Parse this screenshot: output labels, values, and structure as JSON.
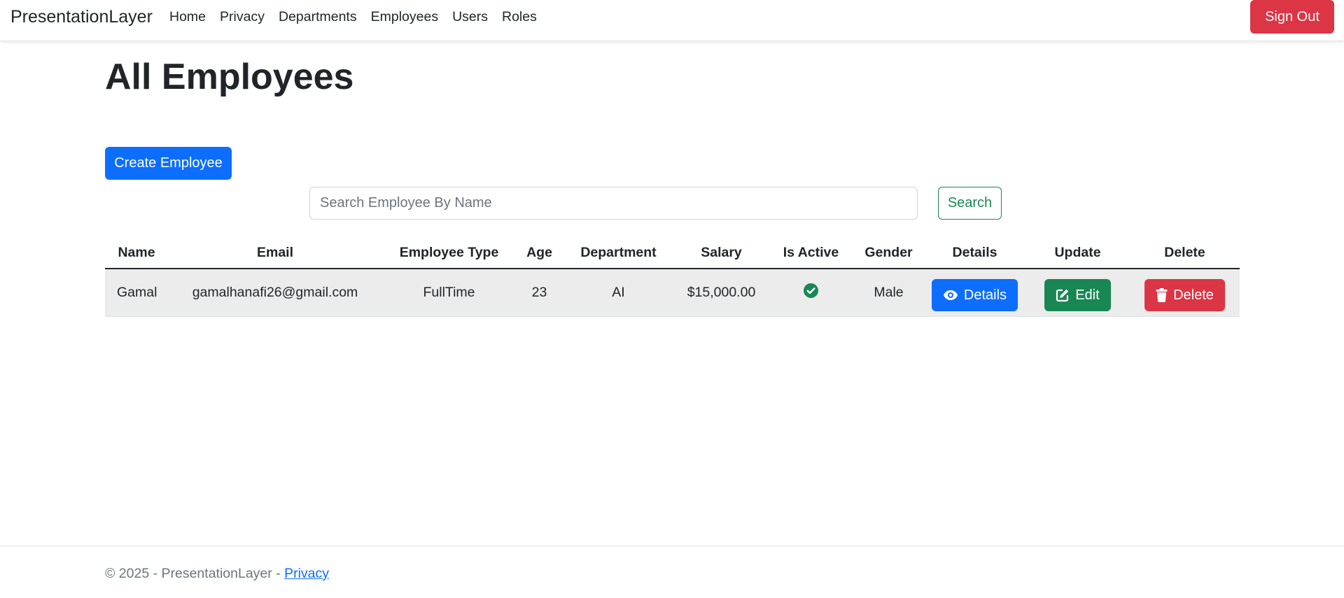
{
  "nav": {
    "brand": "PresentationLayer",
    "links": [
      "Home",
      "Privacy",
      "Departments",
      "Employees",
      "Users",
      "Roles"
    ],
    "signout": "Sign Out"
  },
  "page": {
    "title": "All Employees",
    "create_label": "Create Employee",
    "search_placeholder": "Search Employee By Name",
    "search_value": "",
    "search_label": "Search"
  },
  "table": {
    "headers": [
      "Name",
      "Email",
      "Employee Type",
      "Age",
      "Department",
      "Salary",
      "Is Active",
      "Gender",
      "Details",
      "Update",
      "Delete"
    ],
    "rows": [
      {
        "name": "Gamal",
        "email": "gamalhanafi26@gmail.com",
        "type": "FullTime",
        "age": "23",
        "department": "AI",
        "salary": "$15,000.00",
        "is_active": true,
        "gender": "Male",
        "details_label": "Details",
        "edit_label": "Edit",
        "delete_label": "Delete"
      }
    ]
  },
  "footer": {
    "text": "© 2025 - PresentationLayer - ",
    "link": "Privacy"
  },
  "icons": {
    "details": "eye-icon",
    "edit": "edit-icon",
    "delete": "trash-icon",
    "active": "check-circle-icon"
  },
  "colors": {
    "primary": "#0d6efd",
    "success": "#198754",
    "danger": "#dc3545",
    "active_icon": "#198754"
  }
}
